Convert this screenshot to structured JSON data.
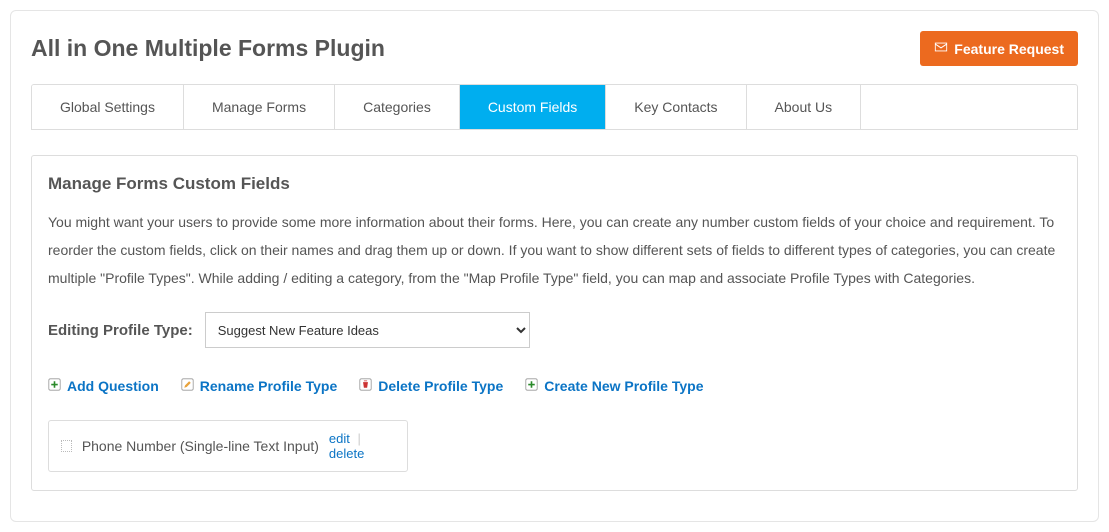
{
  "header": {
    "title": "All in One Multiple Forms Plugin",
    "feature_request_label": "Feature Request"
  },
  "tabs": [
    {
      "label": "Global Settings",
      "active": false
    },
    {
      "label": "Manage Forms",
      "active": false
    },
    {
      "label": "Categories",
      "active": false
    },
    {
      "label": "Custom Fields",
      "active": true
    },
    {
      "label": "Key Contacts",
      "active": false
    },
    {
      "label": "About Us",
      "active": false
    }
  ],
  "panel": {
    "title": "Manage Forms Custom Fields",
    "description": "You might want your users to provide some more information about their forms. Here, you can create any number custom fields of your choice and requirement. To reorder the custom fields, click on their names and drag them up or down. If you want to show different sets of fields to different types of categories, you can create multiple \"Profile Types\". While adding / editing a category, from the \"Map Profile Type\" field, you can map and associate Profile Types with Categories.",
    "edit_label": "Editing Profile Type:",
    "profile_selected": "Suggest New Feature Ideas",
    "actions": {
      "add_question": "Add Question",
      "rename_profile": "Rename Profile Type",
      "delete_profile": "Delete Profile Type",
      "create_profile": "Create New Profile Type"
    },
    "fields": [
      {
        "name": "Phone Number (Single-line Text Input)",
        "edit_label": "edit",
        "delete_label": "delete"
      }
    ]
  }
}
